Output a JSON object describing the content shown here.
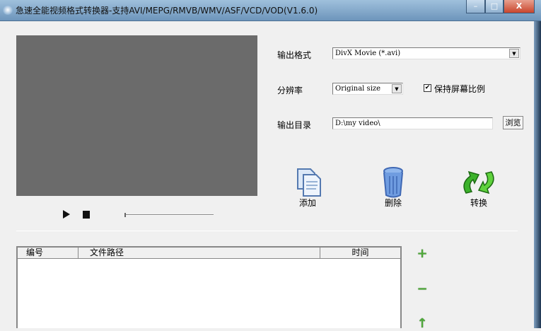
{
  "window": {
    "title": "急速全能视频格式转换器-支持AVI/MEPG/RMVB/WMV/ASF/VCD/VOD(V1.6.0)",
    "minimize": "–",
    "maximize": "□",
    "close": "X"
  },
  "settings": {
    "format_label": "输出格式",
    "format_value": "DivX Movie (*.avi)",
    "resolution_label": "分辨率",
    "resolution_value": "Original size",
    "keep_ratio_label": "保持屏幕比例",
    "keep_ratio_checked": true,
    "outdir_label": "输出目录",
    "outdir_value": "D:\\my video\\",
    "browse_label": "浏览"
  },
  "actions": {
    "add": "添加",
    "delete": "删除",
    "convert": "转换"
  },
  "player": {
    "progress": 0
  },
  "list": {
    "columns": [
      "编号",
      "文件路径",
      "时间"
    ],
    "rows": []
  },
  "side_buttons": {
    "add": "+",
    "remove": "−",
    "up": "↑"
  }
}
